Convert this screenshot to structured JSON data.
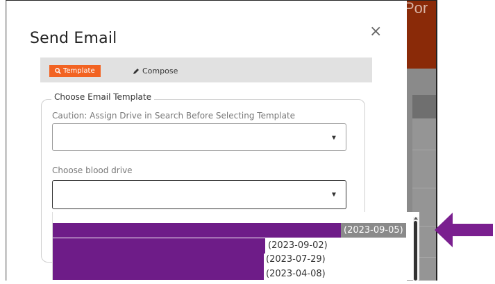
{
  "background": {
    "title_fragment": "Por"
  },
  "modal": {
    "title": "Send Email",
    "close_label": "×"
  },
  "tabs": {
    "template_label": "Template",
    "compose_label": "Compose",
    "template_icon": "search-icon",
    "compose_icon": "pencil-icon",
    "active_color": "#f26322"
  },
  "form": {
    "legend": "Choose Email Template",
    "caution": "Caution: Assign Drive in Search Before Selecting Template",
    "template_select_value": "",
    "blood_drive_label": "Choose blood drive",
    "blood_drive_select_value": ""
  },
  "dropdown": {
    "options": [
      {
        "date": "(2023-09-05)",
        "selected": true
      },
      {
        "date": "(2023-09-02)",
        "selected": false
      },
      {
        "date": "(2023-07-29)",
        "selected": false
      },
      {
        "date": "(2023-04-08)",
        "selected": false
      }
    ],
    "redaction_color": "#6e1c88"
  },
  "annotation": {
    "arrow_color": "#7a1f8f",
    "arrow_direction": "left"
  }
}
